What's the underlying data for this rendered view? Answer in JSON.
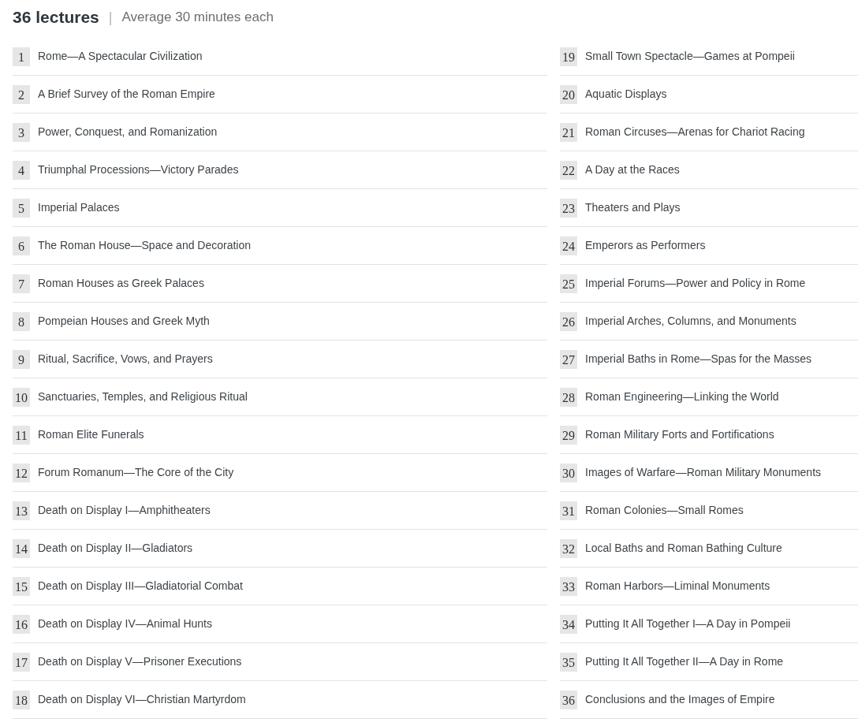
{
  "header": {
    "count": "36 lectures",
    "separator": "|",
    "duration": "Average 30 minutes each"
  },
  "columns": [
    {
      "lectures": [
        {
          "number": "1",
          "title": "Rome—A Spectacular Civilization"
        },
        {
          "number": "2",
          "title": "A Brief Survey of the Roman Empire"
        },
        {
          "number": "3",
          "title": "Power, Conquest, and Romanization"
        },
        {
          "number": "4",
          "title": "Triumphal Processions—Victory Parades"
        },
        {
          "number": "5",
          "title": "Imperial Palaces"
        },
        {
          "number": "6",
          "title": "The Roman House—Space and Decoration"
        },
        {
          "number": "7",
          "title": "Roman Houses as Greek Palaces"
        },
        {
          "number": "8",
          "title": "Pompeian Houses and Greek Myth"
        },
        {
          "number": "9",
          "title": "Ritual, Sacrifice, Vows, and Prayers"
        },
        {
          "number": "10",
          "title": "Sanctuaries, Temples, and Religious Ritual"
        },
        {
          "number": "11",
          "title": "Roman Elite Funerals"
        },
        {
          "number": "12",
          "title": "Forum Romanum—The Core of the City"
        },
        {
          "number": "13",
          "title": "Death on Display I—Amphitheaters"
        },
        {
          "number": "14",
          "title": "Death on Display II—Gladiators"
        },
        {
          "number": "15",
          "title": "Death on Display III—Gladiatorial Combat"
        },
        {
          "number": "16",
          "title": "Death on Display IV—Animal Hunts"
        },
        {
          "number": "17",
          "title": "Death on Display V—Prisoner Executions"
        },
        {
          "number": "18",
          "title": "Death on Display VI—Christian Martyrdom"
        }
      ]
    },
    {
      "lectures": [
        {
          "number": "19",
          "title": "Small Town Spectacle—Games at Pompeii"
        },
        {
          "number": "20",
          "title": "Aquatic Displays"
        },
        {
          "number": "21",
          "title": "Roman Circuses—Arenas for Chariot Racing"
        },
        {
          "number": "22",
          "title": "A Day at the Races"
        },
        {
          "number": "23",
          "title": "Theaters and Plays"
        },
        {
          "number": "24",
          "title": "Emperors as Performers"
        },
        {
          "number": "25",
          "title": "Imperial Forums—Power and Policy in Rome"
        },
        {
          "number": "26",
          "title": "Imperial Arches, Columns, and Monuments"
        },
        {
          "number": "27",
          "title": "Imperial Baths in Rome—Spas for the Masses"
        },
        {
          "number": "28",
          "title": "Roman Engineering—Linking the World"
        },
        {
          "number": "29",
          "title": "Roman Military Forts and Fortifications"
        },
        {
          "number": "30",
          "title": "Images of Warfare—Roman Military Monuments"
        },
        {
          "number": "31",
          "title": "Roman Colonies—Small Romes"
        },
        {
          "number": "32",
          "title": "Local Baths and Roman Bathing Culture"
        },
        {
          "number": "33",
          "title": "Roman Harbors—Liminal Monuments"
        },
        {
          "number": "34",
          "title": "Putting It All Together I—A Day in Pompeii"
        },
        {
          "number": "35",
          "title": "Putting It All Together II—A Day in Rome"
        },
        {
          "number": "36",
          "title": "Conclusions and the Images of Empire"
        }
      ]
    }
  ]
}
